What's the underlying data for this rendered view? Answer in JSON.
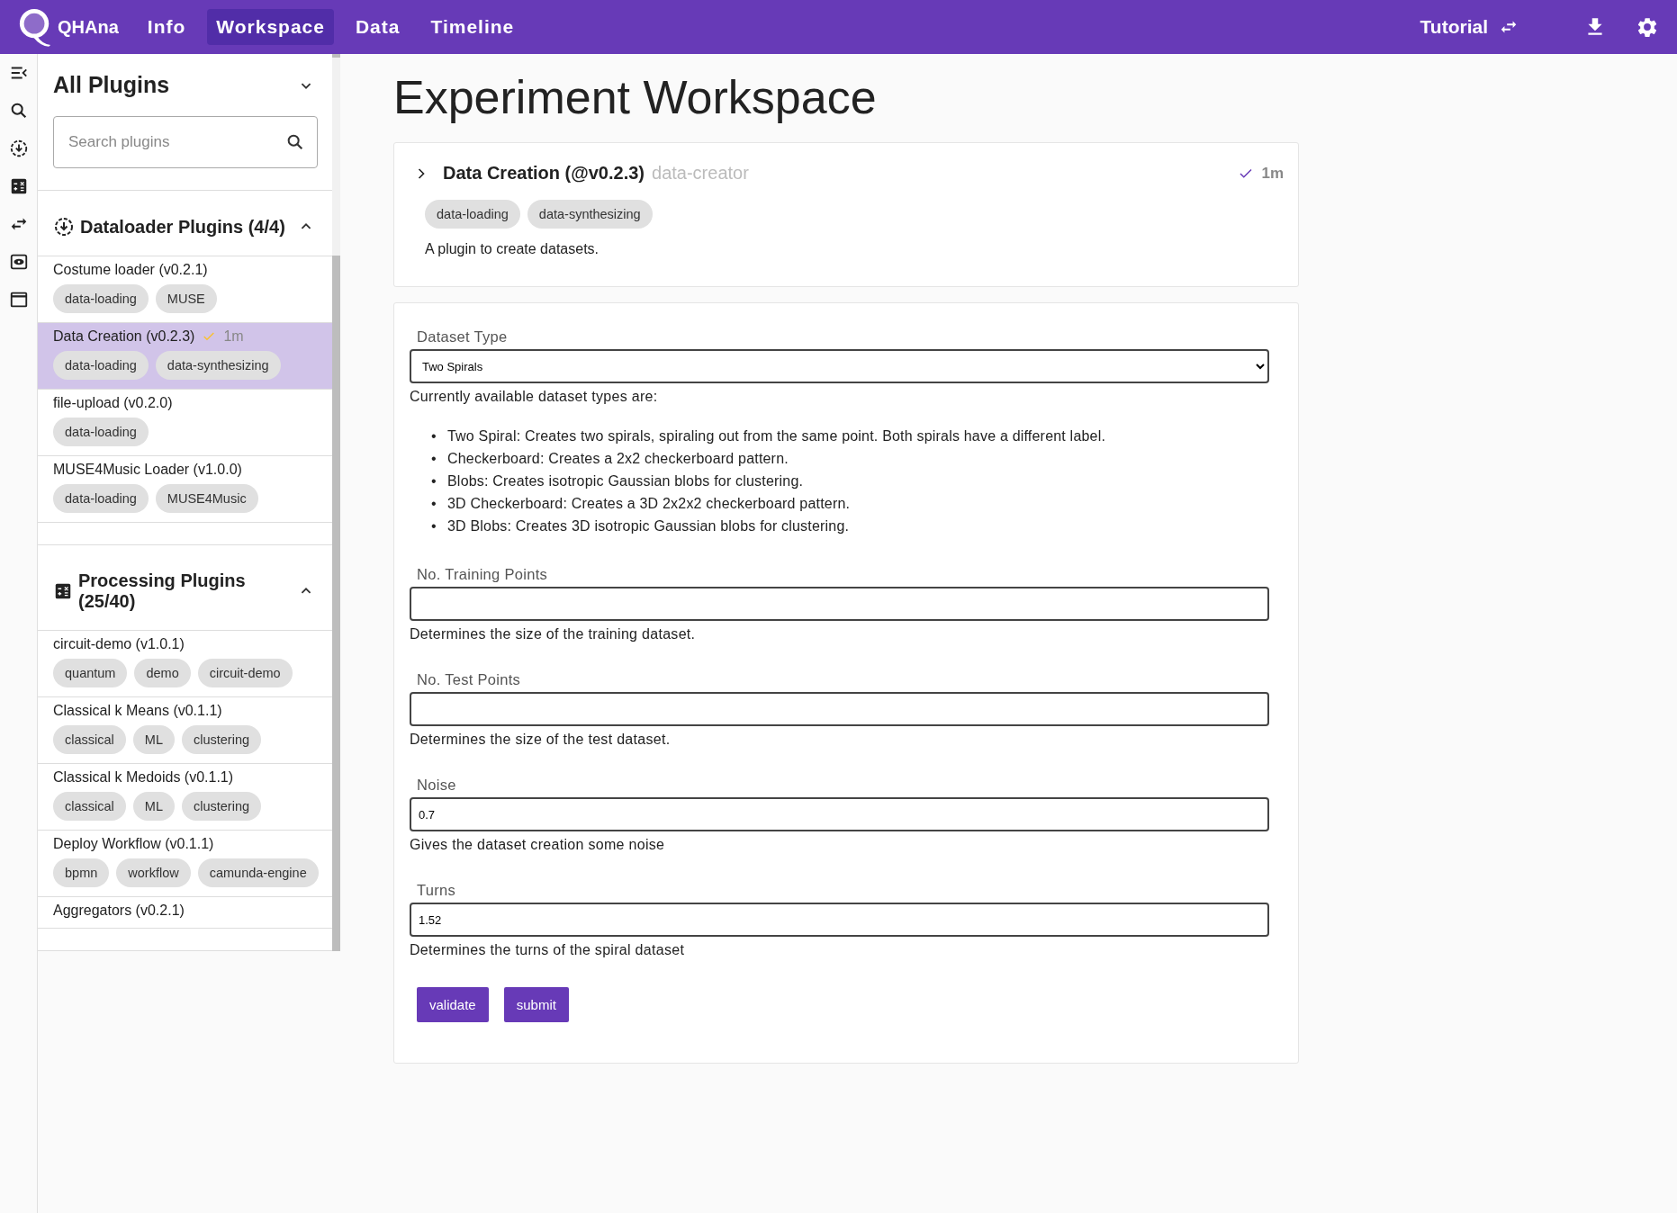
{
  "app": {
    "name": "QHAna"
  },
  "nav": [
    {
      "label": "Info",
      "selected": false
    },
    {
      "label": "Workspace",
      "selected": true
    },
    {
      "label": "Data",
      "selected": false
    },
    {
      "label": "Timeline",
      "selected": false
    }
  ],
  "toolbar": {
    "tutorial": "Tutorial"
  },
  "sidebar": {
    "title": "All Plugins",
    "search": {
      "placeholder": "Search plugins"
    },
    "groups": [
      {
        "kind": "dataloader",
        "title": "Dataloader Plugins (4/4)",
        "expanded": true,
        "plugins": [
          {
            "name": "Costume loader (v0.2.1)",
            "selected": false,
            "tags": [
              "data-loading",
              "MUSE"
            ]
          },
          {
            "name": "Data Creation (v0.2.3)",
            "selected": true,
            "status": "1m",
            "tags": [
              "data-loading",
              "data-synthesizing"
            ]
          },
          {
            "name": "file-upload (v0.2.0)",
            "selected": false,
            "tags": [
              "data-loading"
            ]
          },
          {
            "name": "MUSE4Music Loader (v1.0.0)",
            "selected": false,
            "tags": [
              "data-loading",
              "MUSE4Music"
            ]
          }
        ]
      },
      {
        "kind": "processing",
        "title": "Processing Plugins (25/40)",
        "expanded": true,
        "plugins": [
          {
            "name": "circuit-demo (v1.0.1)",
            "selected": false,
            "tags": [
              "quantum",
              "demo",
              "circuit-demo"
            ]
          },
          {
            "name": "Classical k Means (v0.1.1)",
            "selected": false,
            "tags": [
              "classical",
              "ML",
              "clustering"
            ]
          },
          {
            "name": "Classical k Medoids (v0.1.1)",
            "selected": false,
            "tags": [
              "classical",
              "ML",
              "clustering"
            ]
          },
          {
            "name": "Deploy Workflow (v0.1.1)",
            "selected": false,
            "tags": [
              "bpmn",
              "workflow",
              "camunda-engine"
            ]
          },
          {
            "name": "Aggregators (v0.2.1)",
            "selected": false
          }
        ]
      }
    ]
  },
  "workspace": {
    "title": "Experiment Workspace",
    "plugin_card": {
      "name": "Data Creation (@v0.2.3)",
      "identifier": "data-creator",
      "status": "1m",
      "tags": [
        "data-loading",
        "data-synthesizing"
      ],
      "description": "A plugin to create datasets."
    },
    "form": {
      "fields": [
        {
          "kind": "select",
          "label": "Dataset Type",
          "value": "Two Spirals",
          "help": "Currently available dataset types are:",
          "bullets": [
            {
              "marker": "•",
              "text": "Two Spiral: Creates two spirals, spiraling out from the same point. Both spirals have a different label."
            },
            {
              "marker": "•",
              "text": "Checkerboard: Creates a 2x2 checkerboard pattern."
            },
            {
              "marker": "•",
              "text": "Blobs: Creates isotropic Gaussian blobs for clustering."
            },
            {
              "marker": "•",
              "text": "3D Checkerboard: Creates a 3D 2x2x2 checkerboard pattern."
            },
            {
              "marker": "•",
              "text": "3D Blobs: Creates 3D isotropic Gaussian blobs for clustering."
            }
          ]
        },
        {
          "kind": "text",
          "label": "No. Training Points",
          "help": "Determines the size of the training dataset."
        },
        {
          "kind": "text",
          "label": "No. Test Points",
          "help": "Determines the size of the test dataset."
        },
        {
          "kind": "text",
          "label": "Noise",
          "value": "0.7",
          "help": "Gives the dataset creation some noise"
        },
        {
          "kind": "text",
          "label": "Turns",
          "value": "1.52",
          "help": "Determines the turns of the spiral dataset"
        }
      ],
      "buttons": [
        "validate",
        "submit"
      ]
    }
  }
}
